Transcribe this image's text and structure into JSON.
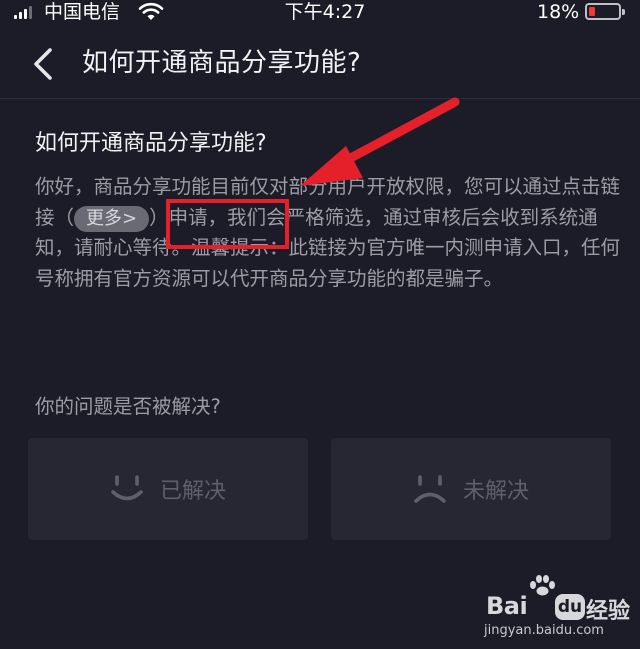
{
  "status_bar": {
    "carrier": "中国电信",
    "time": "下午4:27",
    "battery_percent": "18%",
    "battery_level": 0.18
  },
  "nav": {
    "title": "如何开通商品分享功能?"
  },
  "article": {
    "question_title": "如何开通商品分享功能?",
    "answer_before_link": "你好，商品分享功能目前仅对部分用户开放权限，您可以通过点击链接（",
    "link_label": "更多>",
    "answer_after_link": "）申请，我们会严格筛选，通过审核后会收到系统通知，请耐心等待。温馨提示：此链接为官方唯一内测申请入口，任何号称拥有官方资源可以代开商品分享功能的都是骗子。"
  },
  "feedback": {
    "question": "你的问题是否被解决?",
    "resolved_label": "已解决",
    "unresolved_label": "未解决"
  },
  "watermark": {
    "brand_bai": "Bai",
    "brand_du": "du",
    "brand_jingyan": "经验",
    "url": "jingyan.baidu.com"
  },
  "colors": {
    "background": "#1b1c27",
    "annotation_red": "#e6202a",
    "button_bg": "#262733"
  }
}
